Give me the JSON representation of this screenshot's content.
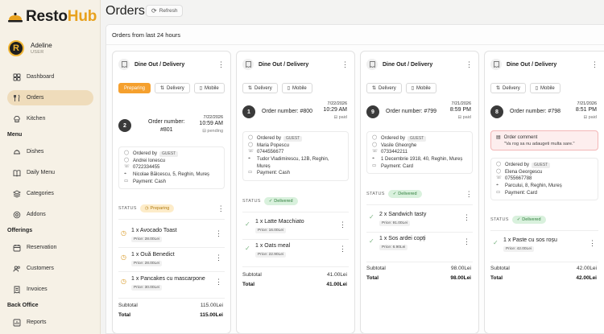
{
  "app": {
    "logo_part1": "Resto",
    "logo_part2": "Hub"
  },
  "user": {
    "initial": "R",
    "name": "Adeline",
    "role": "USER"
  },
  "nav": {
    "dashboard": "Dashboard",
    "orders": "Orders",
    "kitchen": "Kitchen",
    "menu_section": "Menu",
    "dishes": "Dishes",
    "daily_menu": "Daily Menu",
    "categories": "Categories",
    "addons": "Addons",
    "offerings_section": "Offerings",
    "reservation": "Reservation",
    "customers": "Customers",
    "invoices": "Invoices",
    "backoffice_section": "Back Office",
    "reports": "Reports"
  },
  "header": {
    "title": "Orders",
    "refresh_label": "Refresh"
  },
  "panel": {
    "subtitle": "Orders from last 24 hours"
  },
  "labels": {
    "status": "STATUS",
    "subtotal": "Subtotal",
    "total": "Total",
    "ordered_by": "Ordered by",
    "guest": "GUEST",
    "comment_title": "Order comment"
  },
  "orders": [
    {
      "type": "Dine Out / Delivery",
      "chips": [
        "Preparing",
        "Delivery",
        "Mobile"
      ],
      "index": "2",
      "number_label": "Order number:",
      "number": "#801",
      "date": "7/22/2026",
      "time": "10:59 AM",
      "payment_state": "pending",
      "name": "Andrei Ionescu",
      "phone": "0722334455",
      "address": "Nicolae Bălcescu, 5, Reghin, Mureș",
      "payment": "Payment: Cash",
      "status": "Preparing",
      "items": [
        {
          "name": "1 x Avocado Toast",
          "price": "Price: 28.00Lei"
        },
        {
          "name": "1 x Ouă Benedict",
          "price": "Price: 28.00Lei"
        },
        {
          "name": "1 x Pancakes cu mascarpone",
          "price": "Price: 30.00Lei"
        }
      ],
      "subtotal": "115.00Lei",
      "total": "115.00Lei"
    },
    {
      "type": "Dine Out / Delivery",
      "chips": [
        "Delivery",
        "Mobile"
      ],
      "index": "1",
      "number_label": "Order number: #800",
      "date": "7/22/2026",
      "time": "10:29 AM",
      "payment_state": "paid",
      "name": "Maria Popescu",
      "phone": "0744556677",
      "address": "Tudor Vladimirescu, 12B, Reghin, Mureș",
      "payment": "Payment: Cash",
      "status": "Delivered",
      "items": [
        {
          "name": "1 x Latte Macchiato",
          "price": "Price: 16.00Lei"
        },
        {
          "name": "1 x Oats meal",
          "price": "Price: 22.90Lei"
        }
      ],
      "subtotal": "41.00Lei",
      "total": "41.00Lei"
    },
    {
      "type": "Dine Out / Delivery",
      "chips": [
        "Delivery",
        "Mobile"
      ],
      "index": "9",
      "number_label": "Order number: #799",
      "date": "7/21/2026",
      "time": "8:59 PM",
      "payment_state": "paid",
      "name": "Vasile Gheorghe",
      "phone": "0733442211",
      "address": "1 Decembrie 1918, 40, Reghin, Mureș",
      "payment": "Payment: Card",
      "status": "Delivered",
      "items": [
        {
          "name": "2 x Sandwich tasty",
          "price": "Price: 91.00Lei"
        },
        {
          "name": "1 x Sos ardei copți",
          "price": "Price: 6.90Lei"
        }
      ],
      "subtotal": "98.00Lei",
      "total": "98.00Lei"
    },
    {
      "type": "Dine Out / Delivery",
      "chips": [
        "Delivery",
        "Mobile"
      ],
      "index": "8",
      "number_label": "Order number: #798",
      "date": "7/21/2026",
      "time": "8:51 PM",
      "payment_state": "paid",
      "comment": "\"Va rog sa nu adaugeti multa sare.\"",
      "name": "Elena Georgescu",
      "phone": "0755667788",
      "address": "Parcului, 8, Reghin, Mureș",
      "payment": "Payment: Card",
      "status": "Delivered",
      "items": [
        {
          "name": "1 x Paste cu sos roșu",
          "price": "Price: 42.00Lei"
        }
      ],
      "subtotal": "42.00Lei",
      "total": "42.00Lei"
    }
  ]
}
